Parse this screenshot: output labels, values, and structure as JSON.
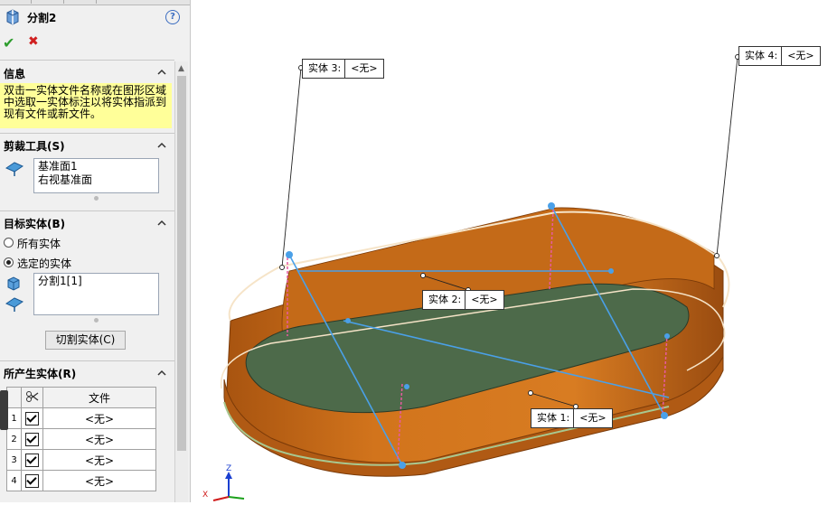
{
  "feature": {
    "title": "分割2",
    "help_icon": "?",
    "ok_icon": "✔",
    "cancel_icon": "✖"
  },
  "info": {
    "header": "信息",
    "text": "双击一实体文件名称或在图形区域中选取一实体标注以将实体指派到现有文件或新文件。"
  },
  "trim_tools": {
    "header": "剪裁工具(S)",
    "items": [
      "基准面1",
      "右视基准面"
    ]
  },
  "target_bodies": {
    "header": "目标实体(B)",
    "options": [
      {
        "label": "所有实体",
        "selected": false
      },
      {
        "label": "选定的实体",
        "selected": true
      }
    ],
    "items": [
      "分割1[1]"
    ]
  },
  "cut_button": "切割实体(C)",
  "resulting_bodies": {
    "header": "所产生实体(R)",
    "column_file": "文件",
    "rows": [
      {
        "num": "1",
        "checked": true,
        "file": "<无>"
      },
      {
        "num": "2",
        "checked": true,
        "file": "<无>"
      },
      {
        "num": "3",
        "checked": true,
        "file": "<无>"
      },
      {
        "num": "4",
        "checked": true,
        "file": "<无>"
      }
    ]
  },
  "callouts": [
    {
      "label": "实体 3:",
      "value": "<无>"
    },
    {
      "label": "实体 4:",
      "value": "<无>"
    },
    {
      "label": "实体 2:",
      "value": "<无>"
    },
    {
      "label": "实体 1:",
      "value": "<无>"
    }
  ],
  "triad": {
    "z": "Z",
    "x": "X"
  },
  "colors": {
    "body": "#d2741c",
    "floor": "#4d6a4a",
    "info_bg": "#ffff99",
    "selection": "#4aa0e8",
    "plane_edge": "#e85aa0"
  }
}
